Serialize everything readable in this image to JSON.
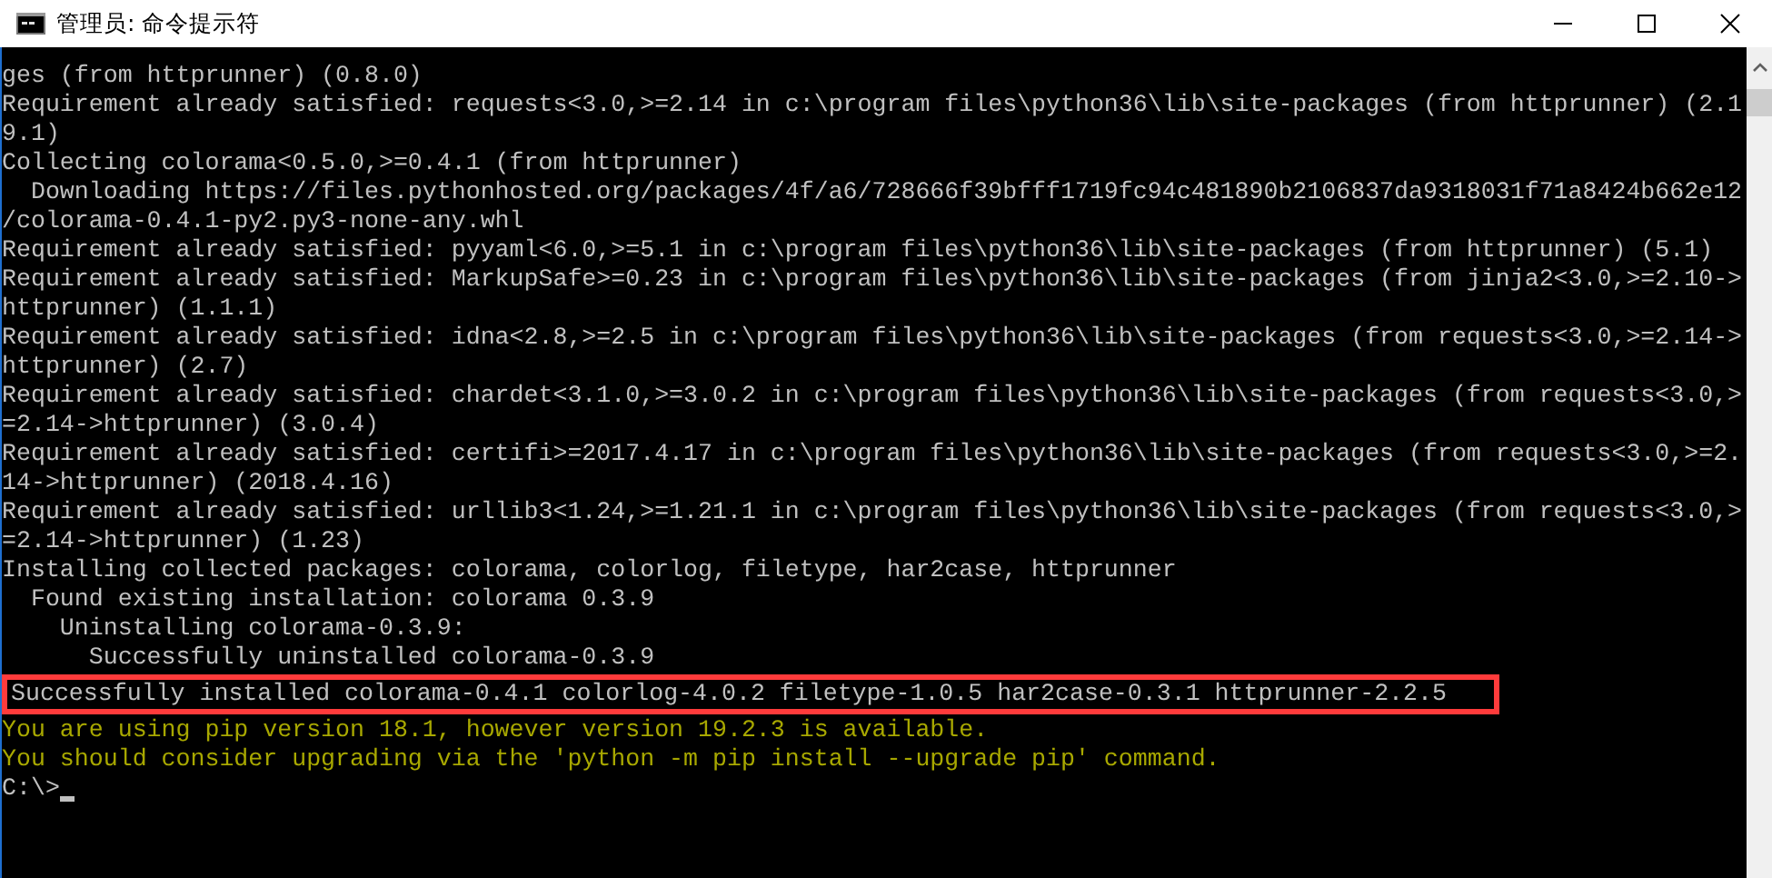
{
  "window": {
    "title": "管理员: 命令提示符"
  },
  "console": {
    "lines": [
      {
        "text": "ges (from httprunner) (0.8.0)",
        "kind": "normal"
      },
      {
        "text": "Requirement already satisfied: requests<3.0,>=2.14 in c:\\program files\\python36\\lib\\site-packages (from httprunner) (2.1",
        "kind": "normal"
      },
      {
        "text": "9.1)",
        "kind": "normal"
      },
      {
        "text": "Collecting colorama<0.5.0,>=0.4.1 (from httprunner)",
        "kind": "normal"
      },
      {
        "text": "  Downloading https://files.pythonhosted.org/packages/4f/a6/728666f39bfff1719fc94c481890b2106837da9318031f71a8424b662e12",
        "kind": "normal"
      },
      {
        "text": "/colorama-0.4.1-py2.py3-none-any.whl",
        "kind": "normal"
      },
      {
        "text": "Requirement already satisfied: pyyaml<6.0,>=5.1 in c:\\program files\\python36\\lib\\site-packages (from httprunner) (5.1)",
        "kind": "normal"
      },
      {
        "text": "Requirement already satisfied: MarkupSafe>=0.23 in c:\\program files\\python36\\lib\\site-packages (from jinja2<3.0,>=2.10->",
        "kind": "normal"
      },
      {
        "text": "httprunner) (1.1.1)",
        "kind": "normal"
      },
      {
        "text": "Requirement already satisfied: idna<2.8,>=2.5 in c:\\program files\\python36\\lib\\site-packages (from requests<3.0,>=2.14->",
        "kind": "normal"
      },
      {
        "text": "httprunner) (2.7)",
        "kind": "normal"
      },
      {
        "text": "Requirement already satisfied: chardet<3.1.0,>=3.0.2 in c:\\program files\\python36\\lib\\site-packages (from requests<3.0,>",
        "kind": "normal"
      },
      {
        "text": "=2.14->httprunner) (3.0.4)",
        "kind": "normal"
      },
      {
        "text": "Requirement already satisfied: certifi>=2017.4.17 in c:\\program files\\python36\\lib\\site-packages (from requests<3.0,>=2.",
        "kind": "normal"
      },
      {
        "text": "14->httprunner) (2018.4.16)",
        "kind": "normal"
      },
      {
        "text": "Requirement already satisfied: urllib3<1.24,>=1.21.1 in c:\\program files\\python36\\lib\\site-packages (from requests<3.0,>",
        "kind": "normal"
      },
      {
        "text": "=2.14->httprunner) (1.23)",
        "kind": "normal"
      },
      {
        "text": "Installing collected packages: colorama, colorlog, filetype, har2case, httprunner",
        "kind": "normal"
      },
      {
        "text": "  Found existing installation: colorama 0.3.9",
        "kind": "normal"
      },
      {
        "text": "    Uninstalling colorama-0.3.9:",
        "kind": "normal"
      },
      {
        "text": "      Successfully uninstalled colorama-0.3.9",
        "kind": "normal"
      },
      {
        "text": "Successfully installed colorama-0.4.1 colorlog-4.0.2 filetype-1.0.5 har2case-0.3.1 httprunner-2.2.5",
        "kind": "normal",
        "highlighted": true
      },
      {
        "text": "You are using pip version 18.1, however version 19.2.3 is available.",
        "kind": "warning"
      },
      {
        "text": "You should consider upgrading via the 'python -m pip install --upgrade pip' command.",
        "kind": "warning"
      },
      {
        "text": "C:\\>",
        "kind": "prompt",
        "cursor": true
      }
    ]
  }
}
